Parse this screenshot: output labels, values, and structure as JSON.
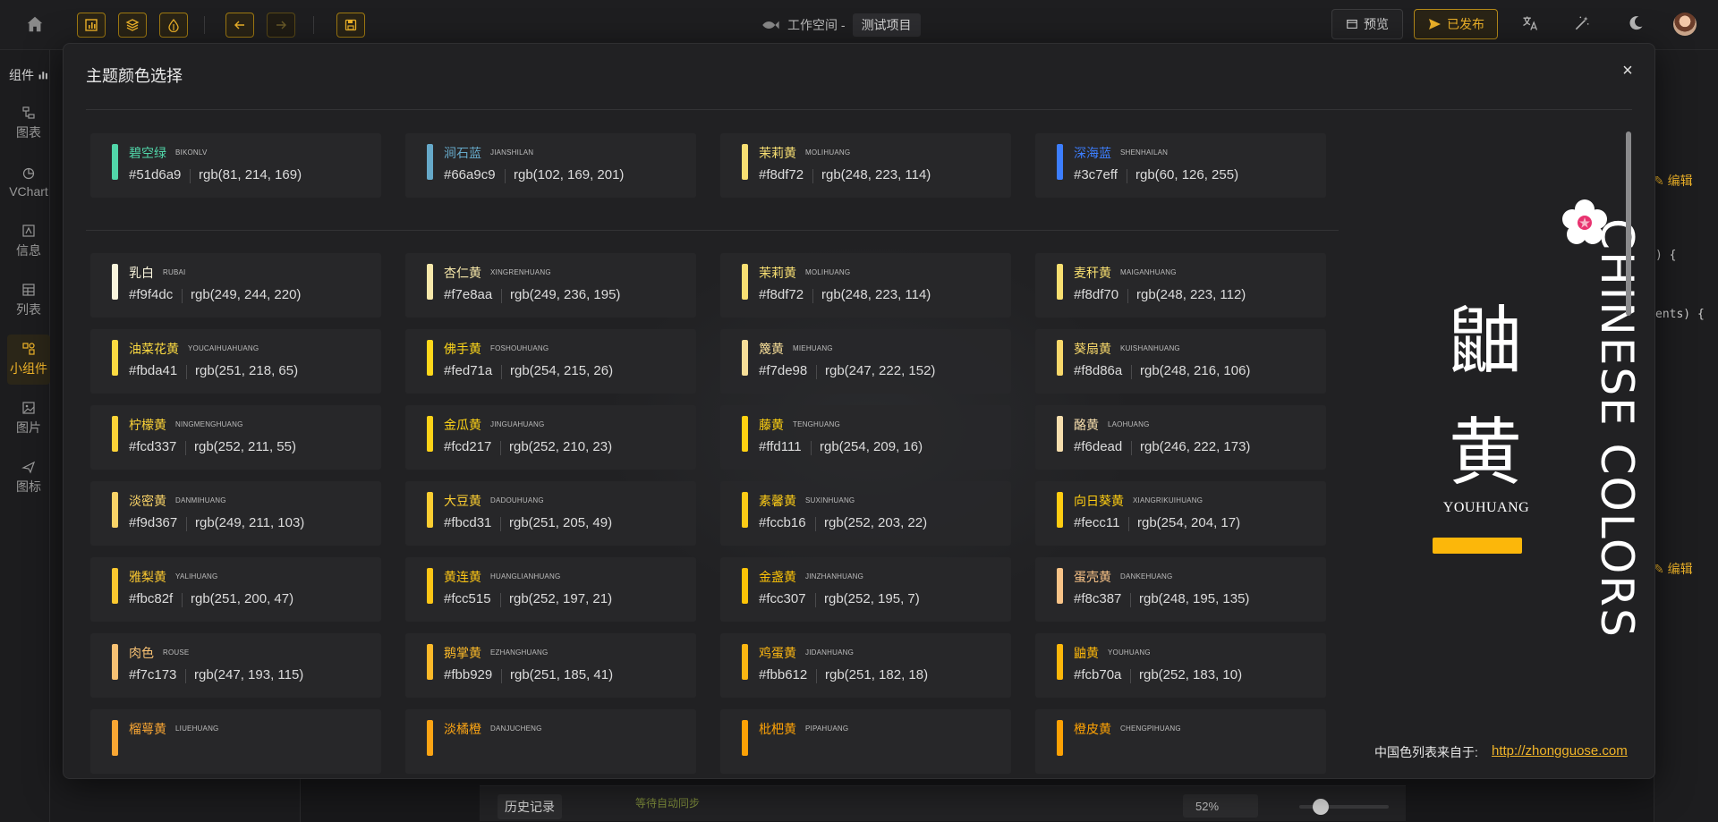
{
  "topbar": {
    "workspace_label": "工作空间 -",
    "project_name": "测试项目",
    "preview_label": "预览",
    "publish_label": "已发布"
  },
  "sidebar": {
    "title": "组件",
    "items": [
      {
        "label": "图表",
        "icon": "flow-icon"
      },
      {
        "label": "VChart",
        "icon": "chart-pie-icon"
      },
      {
        "label": "信息",
        "icon": "text-image-icon"
      },
      {
        "label": "列表",
        "icon": "table-icon"
      },
      {
        "label": "小组件",
        "icon": "widget-icon"
      },
      {
        "label": "图片",
        "icon": "image-icon"
      },
      {
        "label": "图标",
        "icon": "plane-icon"
      }
    ]
  },
  "editor": {
    "edit_label": "编辑",
    "component_label": "组件",
    "code_line1": ") {",
    "code_line2": "ents) {",
    "history_label": "历史记录",
    "sync_status": "等待自动同步",
    "zoom": "52%"
  },
  "modal": {
    "title": "主题颜色选择",
    "close_label": "×",
    "themes": [
      {
        "name": "碧空绿",
        "pinyin": "BIKONLV",
        "hex": "#51d6a9",
        "rgb": "rgb(81, 214, 169)",
        "color": "#51d6a9"
      },
      {
        "name": "涧石蓝",
        "pinyin": "JIANSHILAN",
        "hex": "#66a9c9",
        "rgb": "rgb(102, 169, 201)",
        "color": "#66a9c9"
      },
      {
        "name": "茉莉黄",
        "pinyin": "MOLIHUANG",
        "hex": "#f8df72",
        "rgb": "rgb(248, 223, 114)",
        "color": "#f8df72"
      },
      {
        "name": "深海蓝",
        "pinyin": "SHENHAILAN",
        "hex": "#3c7eff",
        "rgb": "rgb(60, 126, 255)",
        "color": "#3c7eff"
      }
    ],
    "colors": [
      {
        "name": "乳白",
        "pinyin": "RUBAI",
        "hex": "#f9f4dc",
        "rgb": "rgb(249, 244, 220)",
        "color": "#f9f4dc"
      },
      {
        "name": "杏仁黄",
        "pinyin": "XINGRENHUANG",
        "hex": "#f7e8aa",
        "rgb": "rgb(249, 236, 195)",
        "color": "#f7e8aa"
      },
      {
        "name": "茉莉黄",
        "pinyin": "MOLIHUANG",
        "hex": "#f8df72",
        "rgb": "rgb(248, 223, 114)",
        "color": "#f8df72"
      },
      {
        "name": "麦秆黄",
        "pinyin": "MAIGANHUANG",
        "hex": "#f8df70",
        "rgb": "rgb(248, 223, 112)",
        "color": "#f8df70"
      },
      {
        "name": "油菜花黄",
        "pinyin": "YOUCAIHUAHUANG",
        "hex": "#fbda41",
        "rgb": "rgb(251, 218, 65)",
        "color": "#fbda41"
      },
      {
        "name": "佛手黄",
        "pinyin": "FOSHOUHUANG",
        "hex": "#fed71a",
        "rgb": "rgb(254, 215, 26)",
        "color": "#fed71a"
      },
      {
        "name": "篾黄",
        "pinyin": "MIEHUANG",
        "hex": "#f7de98",
        "rgb": "rgb(247, 222, 152)",
        "color": "#f7de98"
      },
      {
        "name": "葵扇黄",
        "pinyin": "KUISHANHUANG",
        "hex": "#f8d86a",
        "rgb": "rgb(248, 216, 106)",
        "color": "#f8d86a"
      },
      {
        "name": "柠檬黄",
        "pinyin": "NINGMENGHUANG",
        "hex": "#fcd337",
        "rgb": "rgb(252, 211, 55)",
        "color": "#fcd337"
      },
      {
        "name": "金瓜黄",
        "pinyin": "JINGUAHUANG",
        "hex": "#fcd217",
        "rgb": "rgb(252, 210, 23)",
        "color": "#fcd217"
      },
      {
        "name": "藤黄",
        "pinyin": "TENGHUANG",
        "hex": "#ffd111",
        "rgb": "rgb(254, 209, 16)",
        "color": "#ffd111"
      },
      {
        "name": "酪黄",
        "pinyin": "LAOHUANG",
        "hex": "#f6dead",
        "rgb": "rgb(246, 222, 173)",
        "color": "#f6dead"
      },
      {
        "name": "淡密黄",
        "pinyin": "DANMIHUANG",
        "hex": "#f9d367",
        "rgb": "rgb(249, 211, 103)",
        "color": "#f9d367"
      },
      {
        "name": "大豆黄",
        "pinyin": "DADOUHUANG",
        "hex": "#fbcd31",
        "rgb": "rgb(251, 205, 49)",
        "color": "#fbcd31"
      },
      {
        "name": "素馨黄",
        "pinyin": "SUXINHUANG",
        "hex": "#fccb16",
        "rgb": "rgb(252, 203, 22)",
        "color": "#fccb16"
      },
      {
        "name": "向日葵黄",
        "pinyin": "XIANGRIKUIHUANG",
        "hex": "#fecc11",
        "rgb": "rgb(254, 204, 17)",
        "color": "#fecc11"
      },
      {
        "name": "雅梨黄",
        "pinyin": "YALIHUANG",
        "hex": "#fbc82f",
        "rgb": "rgb(251, 200, 47)",
        "color": "#fbc82f"
      },
      {
        "name": "黄连黄",
        "pinyin": "HUANGLIANHUANG",
        "hex": "#fcc515",
        "rgb": "rgb(252, 197, 21)",
        "color": "#fcc515"
      },
      {
        "name": "金盏黄",
        "pinyin": "JINZHANHUANG",
        "hex": "#fcc307",
        "rgb": "rgb(252, 195, 7)",
        "color": "#fcc307"
      },
      {
        "name": "蛋壳黄",
        "pinyin": "DANKEHUANG",
        "hex": "#f8c387",
        "rgb": "rgb(248, 195, 135)",
        "color": "#f8c387"
      },
      {
        "name": "肉色",
        "pinyin": "ROUSE",
        "hex": "#f7c173",
        "rgb": "rgb(247, 193, 115)",
        "color": "#f7c173"
      },
      {
        "name": "鹅掌黄",
        "pinyin": "EZHANGHUANG",
        "hex": "#fbb929",
        "rgb": "rgb(251, 185, 41)",
        "color": "#fbb929"
      },
      {
        "name": "鸡蛋黄",
        "pinyin": "JIDANHUANG",
        "hex": "#fbb612",
        "rgb": "rgb(251, 182, 18)",
        "color": "#fbb612"
      },
      {
        "name": "鼬黄",
        "pinyin": "YOUHUANG",
        "hex": "#fcb70a",
        "rgb": "rgb(252, 183, 10)",
        "color": "#fcb70a"
      },
      {
        "name": "榴萼黄",
        "pinyin": "LIUEHUANG",
        "hex": "",
        "rgb": "",
        "color": "#f9a633"
      },
      {
        "name": "淡橘橙",
        "pinyin": "DANJUCHENG",
        "hex": "",
        "rgb": "",
        "color": "#fba414"
      },
      {
        "name": "枇杷黄",
        "pinyin": "PIPAHUANG",
        "hex": "",
        "rgb": "",
        "color": "#fca106"
      },
      {
        "name": "橙皮黄",
        "pinyin": "CHENGPIHUANG",
        "hex": "",
        "rgb": "",
        "color": "#fca104"
      }
    ],
    "feature": {
      "char1": "鼬",
      "char2": "黄",
      "pinyin": "YOUHUANG",
      "color": "#fcb70a",
      "vertical_text": "CHINESE COLORS"
    },
    "source_label": "中国色列表来自于:",
    "source_link": "http://zhongguose.com"
  }
}
